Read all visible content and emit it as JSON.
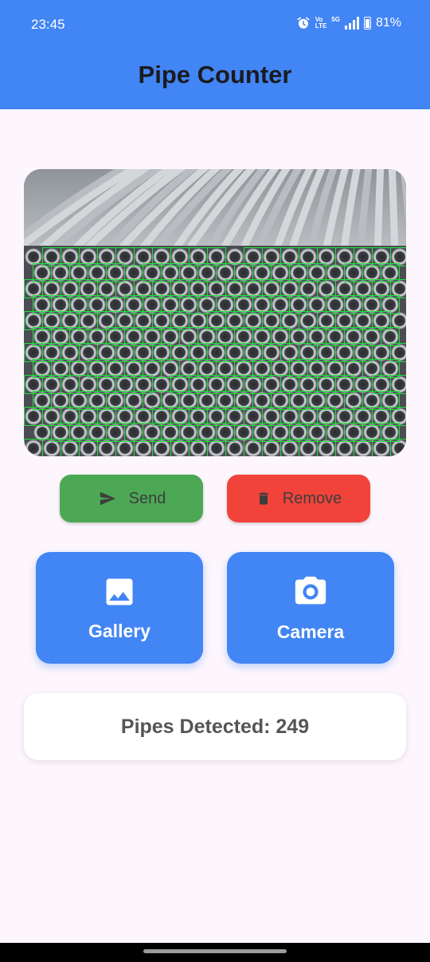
{
  "status_bar": {
    "time": "23:45",
    "network_top": "Vo",
    "network_bottom": "LTE",
    "network_type": "5G",
    "battery": "81%",
    "icons": [
      "alarm-icon",
      "volte-icon",
      "signal-icon",
      "battery-icon"
    ]
  },
  "app": {
    "title": "Pipe Counter"
  },
  "image": {
    "subject": "stacked steel pipes with green detection boxes"
  },
  "actions": {
    "send_label": "Send",
    "remove_label": "Remove",
    "gallery_label": "Gallery",
    "camera_label": "Camera"
  },
  "result": {
    "label": "Pipes Detected: 249",
    "count": 249
  },
  "colors": {
    "primary": "#4285f4",
    "send": "#4ca854",
    "remove": "#f1433a",
    "background": "#fdf6fd",
    "detection": "#22e03a"
  }
}
